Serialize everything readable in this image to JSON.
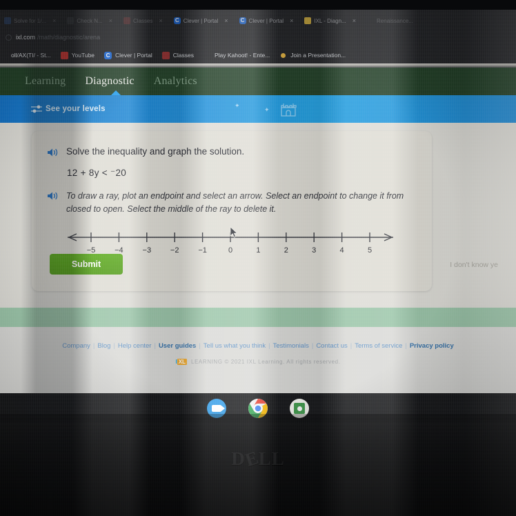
{
  "browser": {
    "tabs": [
      {
        "title": "Solve for 1/...",
        "favicon": "fav-blue",
        "dim": true,
        "close": "×"
      },
      {
        "title": "Check N...",
        "favicon": "fav-grey",
        "dim": true,
        "close": "×"
      },
      {
        "title": "Classes",
        "favicon": "fav-red",
        "dim": true,
        "close": "×"
      },
      {
        "title": "Clever | Portal",
        "favicon": "fav-clever",
        "dim": false,
        "close": "×"
      },
      {
        "title": "Clever | Portal",
        "favicon": "fav-clever",
        "dim": false,
        "close": "×"
      },
      {
        "title": "IXL - Diagn...",
        "favicon": "fav-ixl",
        "dim": false,
        "close": "×"
      },
      {
        "title": "Renaissance...",
        "favicon": "fav-none",
        "dim": true,
        "close": ""
      }
    ],
    "omnibox": {
      "host": "ixl.com",
      "path": "/math/diagnostic/arena",
      "icon": "lock-icon"
    },
    "bookmarks": [
      {
        "label": "oll/AX(TI/ - St...",
        "favicon": "bmf-grey"
      },
      {
        "label": "YouTube",
        "favicon": "bmf-yt"
      },
      {
        "label": "Clever | Portal",
        "favicon": "bmf-cl"
      },
      {
        "label": "Classes",
        "favicon": "bmf-cls"
      },
      {
        "label": "Play Kahoot! - Ente...",
        "favicon": "bmf-none"
      },
      {
        "label": "Join a Presentation...",
        "favicon": "bmf-dot"
      }
    ]
  },
  "nav": {
    "items": [
      {
        "label": "Learning",
        "active": false
      },
      {
        "label": "Diagnostic",
        "active": true
      },
      {
        "label": "Analytics",
        "active": false
      }
    ]
  },
  "levels_band": {
    "label": "See your levels",
    "icon": "sliders-icon",
    "decor_icon": "castle-icon"
  },
  "question": {
    "speaker_icon": "speaker-icon",
    "prompt": "Solve the inequality and graph the solution.",
    "equation": "12 + 8y < ⁻20",
    "instruction": "To draw a ray, plot an endpoint and select an arrow. Select an endpoint to change it from closed to open. Select the middle of the ray to delete it."
  },
  "number_line": {
    "ticks": [
      "-5",
      "-4",
      "-3",
      "-2",
      "-1",
      "0",
      "1",
      "2",
      "3",
      "4",
      "5"
    ],
    "left_arrow": true,
    "right_arrow": true,
    "cursor_at": "0"
  },
  "actions": {
    "submit_label": "Submit",
    "idk_label": "I don't know ye"
  },
  "footer": {
    "links": [
      {
        "label": "Company",
        "bold": false
      },
      {
        "label": "Blog",
        "bold": false
      },
      {
        "label": "Help center",
        "bold": false
      },
      {
        "label": "User guides",
        "bold": false
      },
      {
        "label": "Tell us what you think",
        "bold": false
      },
      {
        "label": "Testimonials",
        "bold": false
      },
      {
        "label": "Contact us",
        "bold": false
      },
      {
        "label": "Terms of service",
        "bold": false
      },
      {
        "label": "Privacy policy",
        "bold": true
      }
    ],
    "copyright": "© 2021 IXL Learning. All rights reserved.",
    "brand_i": "I",
    "brand_xl": "XL",
    "brand_word": "LEARNING"
  },
  "shelf": {
    "icons": [
      {
        "name": "google-meet-icon"
      },
      {
        "name": "google-chrome-icon"
      },
      {
        "name": "google-classroom-icon"
      }
    ]
  },
  "device": {
    "brand_left": "D",
    "brand_e": "E",
    "brand_right": "LL"
  },
  "colors": {
    "nav_green": "#1d3b22",
    "band_blue": "#1a8bd6",
    "submit_green": "#4f9a14",
    "link_blue": "#5e93c9"
  }
}
